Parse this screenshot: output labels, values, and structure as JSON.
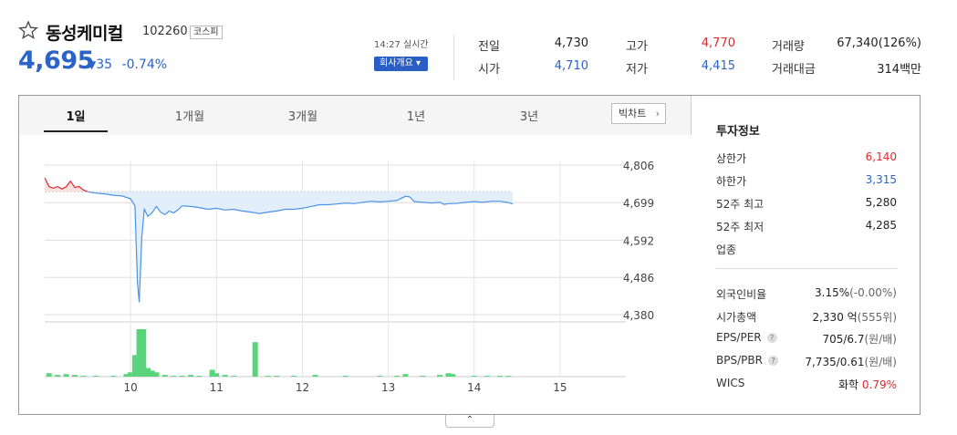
{
  "header": {
    "name": "동성케미컬",
    "code": "102260",
    "market": "코스피",
    "price": "4,695",
    "change_symbol": "▼",
    "change": "35",
    "change_pct": "-0.74%",
    "realtime": "14:27 실시간",
    "overview_btn": "회사개요 ▾"
  },
  "quotes": {
    "prev_label": "전일",
    "prev": "4,730",
    "high_label": "고가",
    "high": "4,770",
    "volume_label": "거래량",
    "volume": "67,340(126%)",
    "open_label": "시가",
    "open": "4,710",
    "low_label": "저가",
    "low": "4,415",
    "amount_label": "거래대금",
    "amount": "314백만"
  },
  "colors": {
    "up": "#e0282e",
    "down": "#2c63c6",
    "volume": "#5ad47c",
    "line": "#4b93e6"
  },
  "tabs": [
    "1일",
    "1개월",
    "3개월",
    "1년",
    "3년"
  ],
  "bigchart": "빅차트",
  "chart_data": {
    "type": "line",
    "y_ticks": [
      "4,806",
      "4,699",
      "4,592",
      "4,486",
      "4,380"
    ],
    "ylim": [
      4380,
      4806
    ],
    "prev_close": 4730,
    "x_ticks": [
      "10",
      "11",
      "12",
      "13",
      "14",
      "15"
    ],
    "x_hours": [
      10,
      11,
      12,
      13,
      14,
      15
    ],
    "time_range": [
      9.0,
      15.5
    ],
    "series": [
      {
        "values": [
          [
            9.0,
            4770
          ],
          [
            9.05,
            4745
          ],
          [
            9.1,
            4740
          ],
          [
            9.15,
            4745
          ],
          [
            9.2,
            4738
          ],
          [
            9.25,
            4744
          ],
          [
            9.3,
            4760
          ],
          [
            9.35,
            4742
          ],
          [
            9.4,
            4745
          ],
          [
            9.45,
            4735
          ],
          [
            9.5,
            4730
          ],
          [
            9.6,
            4726
          ],
          [
            9.7,
            4724
          ],
          [
            9.8,
            4720
          ],
          [
            9.9,
            4718
          ],
          [
            10.0,
            4710
          ],
          [
            10.05,
            4690
          ],
          [
            10.08,
            4470
          ],
          [
            10.1,
            4415
          ],
          [
            10.13,
            4600
          ],
          [
            10.16,
            4680
          ],
          [
            10.2,
            4660
          ],
          [
            10.25,
            4670
          ],
          [
            10.3,
            4688
          ],
          [
            10.35,
            4672
          ],
          [
            10.4,
            4665
          ],
          [
            10.45,
            4675
          ],
          [
            10.5,
            4670
          ],
          [
            10.55,
            4678
          ],
          [
            10.6,
            4690
          ],
          [
            10.7,
            4688
          ],
          [
            10.8,
            4685
          ],
          [
            10.9,
            4680
          ],
          [
            11.0,
            4683
          ],
          [
            11.1,
            4678
          ],
          [
            11.2,
            4680
          ],
          [
            11.3,
            4675
          ],
          [
            11.4,
            4672
          ],
          [
            11.5,
            4668
          ],
          [
            11.6,
            4672
          ],
          [
            11.7,
            4675
          ],
          [
            11.8,
            4680
          ],
          [
            11.9,
            4680
          ],
          [
            12.0,
            4683
          ],
          [
            12.1,
            4688
          ],
          [
            12.2,
            4693
          ],
          [
            12.3,
            4693
          ],
          [
            12.4,
            4695
          ],
          [
            12.5,
            4698
          ],
          [
            12.6,
            4696
          ],
          [
            12.7,
            4700
          ],
          [
            12.8,
            4703
          ],
          [
            12.9,
            4701
          ],
          [
            13.0,
            4703
          ],
          [
            13.1,
            4705
          ],
          [
            13.15,
            4711
          ],
          [
            13.2,
            4717
          ],
          [
            13.25,
            4715
          ],
          [
            13.3,
            4702
          ],
          [
            13.4,
            4700
          ],
          [
            13.5,
            4698
          ],
          [
            13.6,
            4700
          ],
          [
            13.65,
            4694
          ],
          [
            13.7,
            4696
          ],
          [
            13.8,
            4697
          ],
          [
            13.9,
            4700
          ],
          [
            14.0,
            4702
          ],
          [
            14.1,
            4700
          ],
          [
            14.2,
            4703
          ],
          [
            14.3,
            4703
          ],
          [
            14.4,
            4699
          ],
          [
            14.45,
            4695
          ]
        ]
      }
    ],
    "volume": [
      [
        9.05,
        4
      ],
      [
        9.15,
        2
      ],
      [
        9.25,
        3
      ],
      [
        9.35,
        2
      ],
      [
        9.45,
        1
      ],
      [
        9.6,
        1
      ],
      [
        9.8,
        1
      ],
      [
        9.95,
        3
      ],
      [
        10.0,
        5
      ],
      [
        10.05,
        25
      ],
      [
        10.1,
        55
      ],
      [
        10.15,
        55
      ],
      [
        10.2,
        10
      ],
      [
        10.25,
        7
      ],
      [
        10.3,
        5
      ],
      [
        10.4,
        2
      ],
      [
        10.5,
        1
      ],
      [
        10.6,
        1
      ],
      [
        10.7,
        2
      ],
      [
        10.8,
        1
      ],
      [
        10.95,
        8
      ],
      [
        11.0,
        4
      ],
      [
        11.1,
        2
      ],
      [
        11.2,
        1
      ],
      [
        11.45,
        40
      ],
      [
        11.6,
        1
      ],
      [
        11.7,
        1
      ],
      [
        11.9,
        1
      ],
      [
        12.15,
        2
      ],
      [
        12.5,
        1
      ],
      [
        12.9,
        1
      ],
      [
        13.1,
        1
      ],
      [
        13.2,
        3
      ],
      [
        13.4,
        1
      ],
      [
        13.6,
        2
      ],
      [
        13.7,
        4
      ],
      [
        13.75,
        3
      ],
      [
        14.0,
        1
      ],
      [
        14.15,
        1
      ],
      [
        14.3,
        1
      ],
      [
        14.4,
        1
      ]
    ]
  },
  "info": {
    "title": "투자정보",
    "upper_label": "상한가",
    "upper": "6,140",
    "lower_label": "하한가",
    "lower": "3,315",
    "high52_label": "52주 최고",
    "high52": "5,280",
    "low52_label": "52주 최저",
    "low52": "4,285",
    "sector_label": "업종",
    "foreign_label": "외국인비율",
    "foreign": "3.15%",
    "foreign_sub": "(-0.00%)",
    "cap_label": "시가총액",
    "cap": "2,330 억",
    "cap_sub": "(555위)",
    "eps_label": "EPS/PER",
    "eps": "705/6.7",
    "eps_sub": "(원/배)",
    "bps_label": "BPS/PBR",
    "bps": "7,735/0.61",
    "bps_sub": "(원/배)",
    "wics_label": "WICS",
    "wics": "화학",
    "wics_pct": "0.79%"
  },
  "collapse": "⌃"
}
